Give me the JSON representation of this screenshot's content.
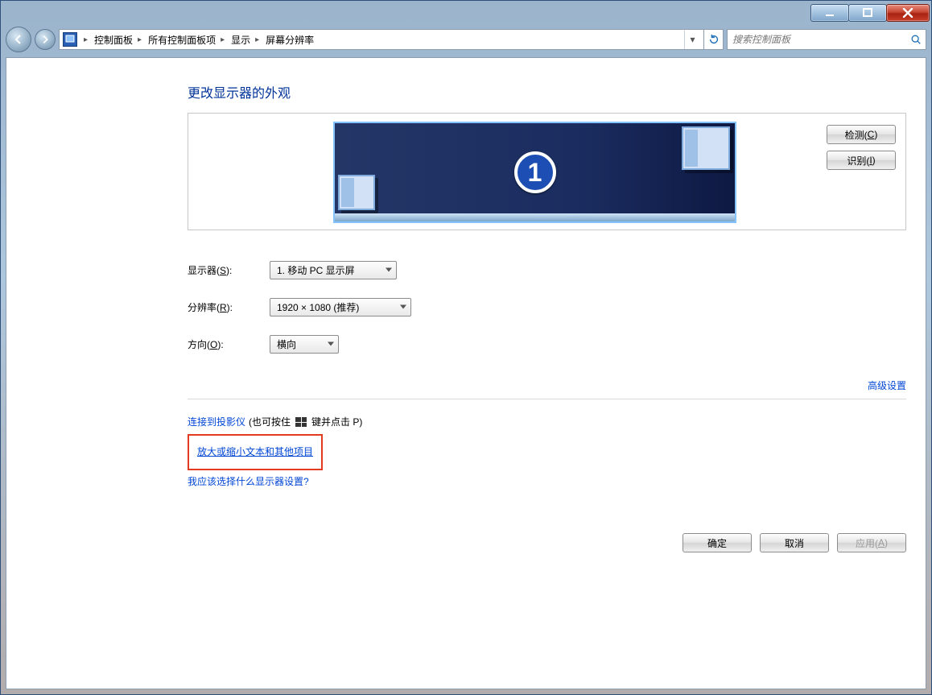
{
  "breadcrumb": {
    "items": [
      "控制面板",
      "所有控制面板项",
      "显示",
      "屏幕分辨率"
    ]
  },
  "search": {
    "placeholder": "搜索控制面板"
  },
  "page": {
    "title": "更改显示器的外观",
    "detect": "检测(C)",
    "identify": "识别(I)",
    "display_num": "1"
  },
  "form": {
    "display_label": "显示器(S):",
    "display_value": "1. 移动 PC 显示屏",
    "res_label": "分辨率(R):",
    "res_value": "1920 × 1080 (推荐)",
    "orient_label": "方向(O):",
    "orient_value": "横向"
  },
  "advanced": "高级设置",
  "links": {
    "projector_a": "连接到投影仪",
    "projector_b": "(也可按住",
    "projector_c": "键并点击 P)",
    "textsize": "放大或缩小文本和其他项目",
    "which": "我应该选择什么显示器设置?"
  },
  "buttons": {
    "ok": "确定",
    "cancel": "取消",
    "apply": "应用(A)"
  }
}
